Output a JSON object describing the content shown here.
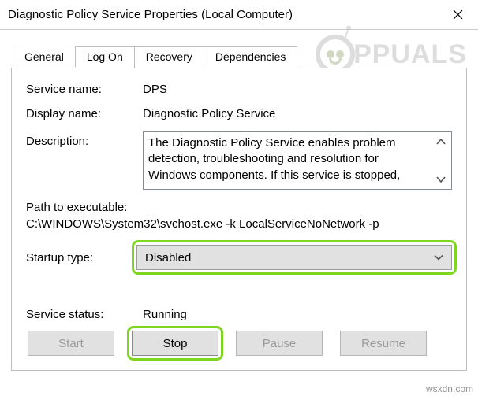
{
  "window": {
    "title": "Diagnostic Policy Service Properties (Local Computer)"
  },
  "tabs": {
    "general": "General",
    "logon": "Log On",
    "recovery": "Recovery",
    "dependencies": "Dependencies"
  },
  "labels": {
    "service_name": "Service name:",
    "display_name": "Display name:",
    "description": "Description:",
    "path_to_exe": "Path to executable:",
    "startup_type": "Startup type:",
    "service_status": "Service status:"
  },
  "values": {
    "service_name": "DPS",
    "display_name": "Diagnostic Policy Service",
    "description": "The Diagnostic Policy Service enables problem detection, troubleshooting and resolution for Windows components.  If this service is stopped,",
    "exe_path": "C:\\WINDOWS\\System32\\svchost.exe -k LocalServiceNoNetwork -p",
    "startup_type": "Disabled",
    "service_status": "Running"
  },
  "buttons": {
    "start": "Start",
    "stop": "Stop",
    "pause": "Pause",
    "resume": "Resume"
  },
  "watermark": {
    "brand": "PPUALS",
    "site": "wsxdn.com"
  }
}
